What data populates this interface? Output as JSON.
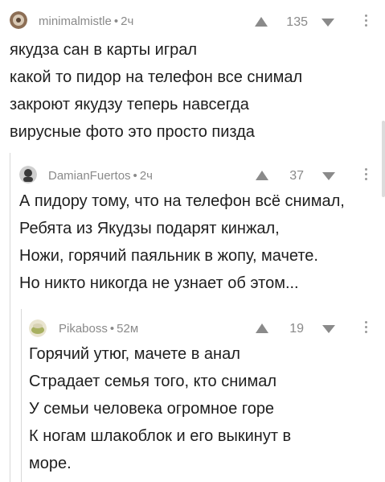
{
  "comments": [
    {
      "author": "minimalmistle",
      "time": "2ч",
      "rating": "135",
      "lines": [
        "якудза сан в карты играл",
        "какой то пидор на телефон все снимал",
        "закроют якудзу теперь навсегда",
        "вирусные фото это просто пизда"
      ]
    },
    {
      "author": "DamianFuertos",
      "time": "2ч",
      "rating": "37",
      "lines": [
        "А пидору тому, что на телефон всё снимал,",
        "Ребята из Якудзы подарят кинжал,",
        "Ножи, горячий паяльник в жопу, мачете.",
        "Но никто никогда не узнает об этом..."
      ]
    },
    {
      "author": "Pikaboss",
      "time": "52м",
      "rating": "19",
      "lines": [
        "Горячий утюг, мачете в анал",
        "Страдает семья того, кто снимал",
        "У семьи человека огромное горе",
        "К ногам шлакоблок и его выкинут в",
        "море."
      ]
    }
  ],
  "separator": "•",
  "icons": {
    "upvote": "triangle-up-icon",
    "downvote": "chevron-down-icon",
    "more": "more-vertical-icon"
  },
  "colors": {
    "meta_gray": "#8a8a8a",
    "thread_line": "#d8d8d8",
    "text": "#1e1e1e"
  }
}
